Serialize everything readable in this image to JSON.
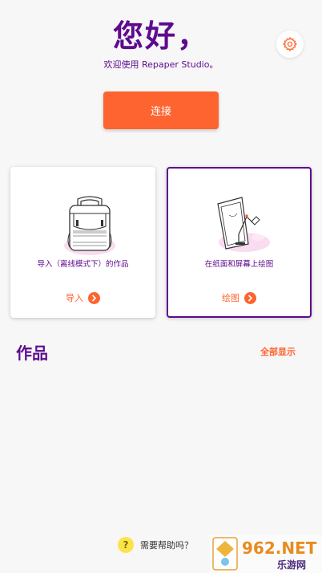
{
  "header": {
    "greeting": "您好，",
    "welcome": "欢迎使用 Repaper Studio。",
    "settings_icon": "gear-icon"
  },
  "connect_button": {
    "label": "连接"
  },
  "cards": [
    {
      "description": "导入（离线模式下）的作品",
      "action_label": "导入",
      "icon": "backpack-icon"
    },
    {
      "description": "在纸面和屏幕上绘图",
      "action_label": "绘图",
      "icon": "drawing-desk-icon"
    }
  ],
  "works": {
    "title": "作品",
    "show_all": "全部显示"
  },
  "help": {
    "icon_char": "?",
    "label": "需要帮助吗？"
  },
  "watermark": {
    "text": "962.NET",
    "subtext": "乐游网"
  },
  "colors": {
    "primary": "#5e0a8e",
    "accent": "#fe6430",
    "background": "#f7f7f7",
    "help": "#fde34a"
  }
}
